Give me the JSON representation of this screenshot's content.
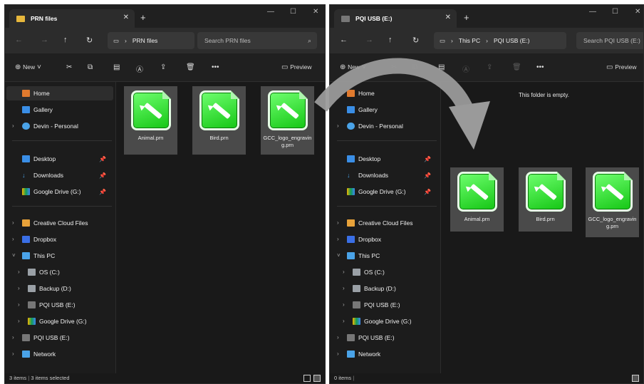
{
  "left": {
    "tab_title": "PRN files",
    "breadcrumb": [
      "PRN files"
    ],
    "search_placeholder": "Search PRN files",
    "toolbar": {
      "new_label": "New",
      "preview_label": "Preview"
    },
    "status_left": "3 items",
    "status_sel": "3 items selected",
    "files": [
      {
        "name": "Animal.prn"
      },
      {
        "name": "Bird.prn"
      },
      {
        "name": "GCC_logo_engraving.prn"
      }
    ]
  },
  "right": {
    "tab_title": "PQI USB (E:)",
    "breadcrumb": [
      "This PC",
      "PQI USB (E:)"
    ],
    "search_placeholder": "Search PQI USB (E:)",
    "toolbar": {
      "new_label": "New",
      "preview_label": "Preview"
    },
    "empty_text": "This folder is empty.",
    "status_left": "0 items",
    "files": [
      {
        "name": "Animal.prn"
      },
      {
        "name": "Bird.prn"
      },
      {
        "name": "GCC_logo_engraving.prn"
      }
    ]
  },
  "sidebar": {
    "home": "Home",
    "gallery": "Gallery",
    "onedrive": "Devin - Personal",
    "desktop": "Desktop",
    "downloads": "Downloads",
    "gdrive_pinned": "Google Drive (G:)",
    "creative_cloud": "Creative Cloud Files",
    "dropbox": "Dropbox",
    "this_pc": "This PC",
    "os": "OS (C:)",
    "backup": "Backup (D:)",
    "pqi_sub": "PQI USB (E:)",
    "gdrive_sub": "Google Drive (G:)",
    "pqi_root": "PQI USB (E:)",
    "network": "Network"
  },
  "colors": {
    "accent_green": "#15c615",
    "bg": "#191919"
  }
}
